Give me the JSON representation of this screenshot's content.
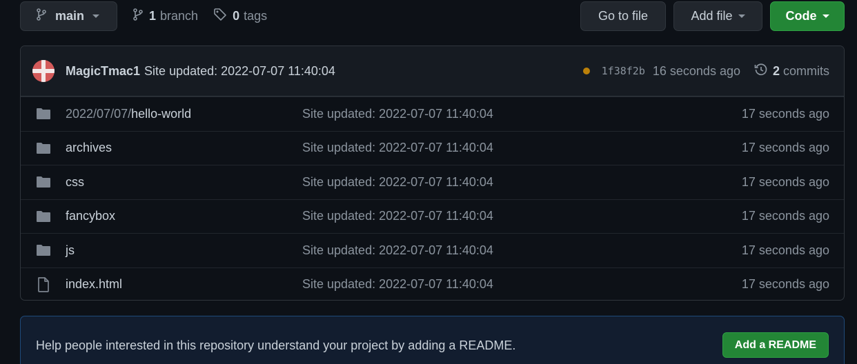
{
  "toolbar": {
    "branch_name": "main",
    "branches_count": "1",
    "branches_label": "branch",
    "tags_count": "0",
    "tags_label": "tags",
    "go_to_file_label": "Go to file",
    "add_file_label": "Add file",
    "code_label": "Code"
  },
  "latest_commit": {
    "author": "MagicTmac1",
    "message": "Site updated: 2022-07-07 11:40:04",
    "status": "pending",
    "status_color": "#bb8009",
    "sha": "1f38f2b",
    "time": "16 seconds ago",
    "commits_count": "2",
    "commits_label": "commits"
  },
  "files": [
    {
      "type": "directory",
      "icon": "folder-icon",
      "prefix": "2022/07/07/",
      "name": "hello-world",
      "message": "Site updated: 2022-07-07 11:40:04",
      "age": "17 seconds ago"
    },
    {
      "type": "directory",
      "icon": "folder-icon",
      "prefix": "",
      "name": "archives",
      "message": "Site updated: 2022-07-07 11:40:04",
      "age": "17 seconds ago"
    },
    {
      "type": "directory",
      "icon": "folder-icon",
      "prefix": "",
      "name": "css",
      "message": "Site updated: 2022-07-07 11:40:04",
      "age": "17 seconds ago"
    },
    {
      "type": "directory",
      "icon": "folder-icon",
      "prefix": "",
      "name": "fancybox",
      "message": "Site updated: 2022-07-07 11:40:04",
      "age": "17 seconds ago"
    },
    {
      "type": "directory",
      "icon": "folder-icon",
      "prefix": "",
      "name": "js",
      "message": "Site updated: 2022-07-07 11:40:04",
      "age": "17 seconds ago"
    },
    {
      "type": "file",
      "icon": "file-icon",
      "prefix": "",
      "name": "index.html",
      "message": "Site updated: 2022-07-07 11:40:04",
      "age": "17 seconds ago"
    }
  ],
  "readme_banner": {
    "text": "Help people interested in this repository understand your project by adding a README.",
    "button_label": "Add a README"
  },
  "colors": {
    "background": "#0d1117",
    "primary_button": "#238636",
    "border": "#30363d"
  }
}
